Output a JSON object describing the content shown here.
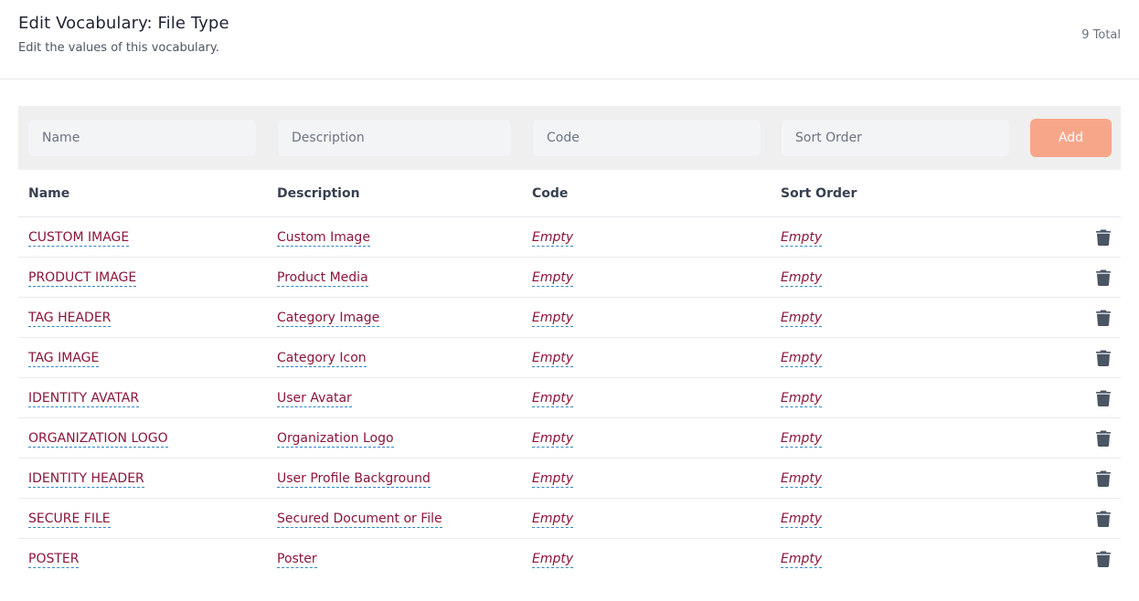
{
  "header": {
    "title": "Edit Vocabulary: File Type",
    "subtitle": "Edit the values of this vocabulary.",
    "total": "9 Total"
  },
  "add_form": {
    "name_placeholder": "Name",
    "description_placeholder": "Description",
    "code_placeholder": "Code",
    "sort_order_placeholder": "Sort Order",
    "add_label": "Add"
  },
  "colors": {
    "accent": "#8b1538",
    "add_button": "#f8a68a",
    "link_underline": "#2f86c7"
  },
  "table": {
    "columns": [
      "Name",
      "Description",
      "Code",
      "Sort Order"
    ],
    "rows": [
      {
        "name": "CUSTOM IMAGE",
        "description": "Custom Image",
        "code": "Empty",
        "sort_order": "Empty"
      },
      {
        "name": "PRODUCT IMAGE",
        "description": "Product Media",
        "code": "Empty",
        "sort_order": "Empty"
      },
      {
        "name": "TAG HEADER",
        "description": "Category Image",
        "code": "Empty",
        "sort_order": "Empty"
      },
      {
        "name": "TAG IMAGE",
        "description": "Category Icon",
        "code": "Empty",
        "sort_order": "Empty"
      },
      {
        "name": "IDENTITY AVATAR",
        "description": "User Avatar",
        "code": "Empty",
        "sort_order": "Empty"
      },
      {
        "name": "ORGANIZATION LOGO",
        "description": "Organization Logo",
        "code": "Empty",
        "sort_order": "Empty"
      },
      {
        "name": "IDENTITY HEADER",
        "description": "User Profile Background",
        "code": "Empty",
        "sort_order": "Empty"
      },
      {
        "name": "SECURE FILE",
        "description": "Secured Document or File",
        "code": "Empty",
        "sort_order": "Empty"
      },
      {
        "name": "POSTER",
        "description": "Poster",
        "code": "Empty",
        "sort_order": "Empty"
      }
    ],
    "row_action_icon": "trash-icon"
  }
}
